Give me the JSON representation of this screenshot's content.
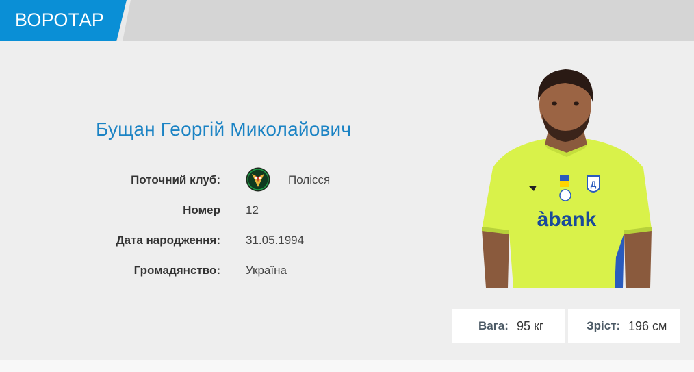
{
  "header": {
    "position": "ВОРОТАР"
  },
  "player": {
    "name": "Бущан Георгій Миколайович",
    "fields": {
      "club": {
        "label": "Поточний клуб:",
        "value": "Полісся",
        "logo": "polissia-club-logo"
      },
      "number": {
        "label": "Номер",
        "value": "12"
      },
      "birthdate": {
        "label": "Дата народження:",
        "value": "31.05.1994"
      },
      "citizenship": {
        "label": "Громадянство:",
        "value": "Україна"
      }
    },
    "stats": {
      "weight": {
        "label": "Вага:",
        "value": "95 кг"
      },
      "height": {
        "label": "Зріст:",
        "value": "196 см"
      }
    },
    "jersey_sponsor": "àbank",
    "photo": "player-photo"
  },
  "colors": {
    "accent": "#0a8fd6",
    "name": "#1b83c4",
    "jersey": "#d9f24a"
  }
}
